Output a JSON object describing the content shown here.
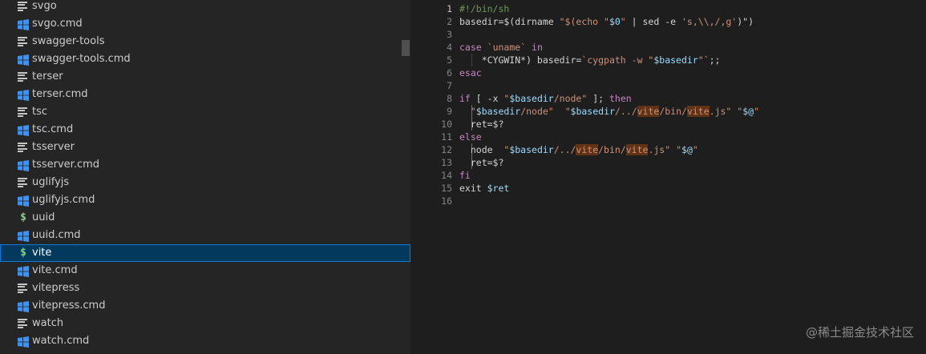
{
  "explorer": {
    "items": [
      {
        "label": "svgo",
        "icon": "file-lines-icon"
      },
      {
        "label": "svgo.cmd",
        "icon": "windows-icon"
      },
      {
        "label": "swagger-tools",
        "icon": "file-lines-icon"
      },
      {
        "label": "swagger-tools.cmd",
        "icon": "windows-icon"
      },
      {
        "label": "terser",
        "icon": "file-lines-icon"
      },
      {
        "label": "terser.cmd",
        "icon": "windows-icon"
      },
      {
        "label": "tsc",
        "icon": "file-lines-icon"
      },
      {
        "label": "tsc.cmd",
        "icon": "windows-icon"
      },
      {
        "label": "tsserver",
        "icon": "file-lines-icon"
      },
      {
        "label": "tsserver.cmd",
        "icon": "windows-icon"
      },
      {
        "label": "uglifyjs",
        "icon": "file-lines-icon"
      },
      {
        "label": "uglifyjs.cmd",
        "icon": "windows-icon"
      },
      {
        "label": "uuid",
        "icon": "shell-dollar-icon"
      },
      {
        "label": "uuid.cmd",
        "icon": "windows-icon"
      },
      {
        "label": "vite",
        "icon": "shell-dollar-icon",
        "selected": true
      },
      {
        "label": "vite.cmd",
        "icon": "windows-icon"
      },
      {
        "label": "vitepress",
        "icon": "file-lines-icon"
      },
      {
        "label": "vitepress.cmd",
        "icon": "windows-icon"
      },
      {
        "label": "watch",
        "icon": "file-lines-icon"
      },
      {
        "label": "watch.cmd",
        "icon": "windows-icon"
      }
    ]
  },
  "editor": {
    "active_line": 1,
    "lines": [
      {
        "n": "1",
        "tokens": [
          [
            "c",
            "#!/bin/sh"
          ]
        ]
      },
      {
        "n": "2",
        "tokens": [
          [
            "",
            "basedir=$(dirname "
          ],
          [
            "s",
            "\"$(echo \""
          ],
          [
            "v",
            "$0"
          ],
          [
            "s",
            "\""
          ],
          [
            "",
            " | sed -e "
          ],
          [
            "s",
            "'s,\\\\,/,g'"
          ],
          [
            "",
            ")\")"
          ]
        ]
      },
      {
        "n": "3",
        "tokens": []
      },
      {
        "n": "4",
        "tokens": [
          [
            "k",
            "case"
          ],
          [
            "",
            " "
          ],
          [
            "s",
            "`uname`"
          ],
          [
            "",
            " "
          ],
          [
            "k",
            "in"
          ]
        ]
      },
      {
        "n": "5",
        "guide": true,
        "tokens": [
          [
            "",
            "    *CYGWIN*) basedir="
          ],
          [
            "s",
            "`cygpath -w \""
          ],
          [
            "v",
            "$basedir"
          ],
          [
            "s",
            "\"`"
          ],
          [
            "",
            ";;"
          ]
        ]
      },
      {
        "n": "6",
        "tokens": [
          [
            "k",
            "esac"
          ]
        ]
      },
      {
        "n": "7",
        "tokens": []
      },
      {
        "n": "8",
        "tokens": [
          [
            "k",
            "if"
          ],
          [
            "",
            " [ -x "
          ],
          [
            "s",
            "\""
          ],
          [
            "v",
            "$basedir"
          ],
          [
            "s",
            "/node\""
          ],
          [
            "",
            " ]; "
          ],
          [
            "k",
            "then"
          ]
        ]
      },
      {
        "n": "9",
        "guide": true,
        "tokens": [
          [
            "",
            "  "
          ],
          [
            "s",
            "\""
          ],
          [
            "v",
            "$basedir"
          ],
          [
            "s",
            "/node\""
          ],
          [
            "",
            "  "
          ],
          [
            "s",
            "\""
          ],
          [
            "v",
            "$basedir"
          ],
          [
            "s",
            "/../"
          ],
          [
            "h",
            "vite"
          ],
          [
            "s",
            "/bin/"
          ],
          [
            "h",
            "vite"
          ],
          [
            "s",
            ".js\""
          ],
          [
            "",
            " "
          ],
          [
            "s",
            "\""
          ],
          [
            "v",
            "$@"
          ],
          [
            "s",
            "\""
          ]
        ]
      },
      {
        "n": "10",
        "guide": true,
        "tokens": [
          [
            "",
            "  ret=$?"
          ]
        ]
      },
      {
        "n": "11",
        "tokens": [
          [
            "k",
            "else"
          ]
        ]
      },
      {
        "n": "12",
        "guide": true,
        "tokens": [
          [
            "",
            "  node  "
          ],
          [
            "s",
            "\""
          ],
          [
            "v",
            "$basedir"
          ],
          [
            "s",
            "/../"
          ],
          [
            "h",
            "vite"
          ],
          [
            "s",
            "/bin/"
          ],
          [
            "h",
            "vite"
          ],
          [
            "s",
            ".js\""
          ],
          [
            "",
            " "
          ],
          [
            "s",
            "\""
          ],
          [
            "v",
            "$@"
          ],
          [
            "s",
            "\""
          ]
        ]
      },
      {
        "n": "13",
        "guide": true,
        "tokens": [
          [
            "",
            "  ret=$?"
          ]
        ]
      },
      {
        "n": "14",
        "tokens": [
          [
            "k",
            "fi"
          ]
        ]
      },
      {
        "n": "15",
        "tokens": [
          [
            "",
            "exit "
          ],
          [
            "v",
            "$ret"
          ]
        ]
      },
      {
        "n": "16",
        "tokens": []
      }
    ]
  },
  "watermark": "@稀土掘金技术社区"
}
